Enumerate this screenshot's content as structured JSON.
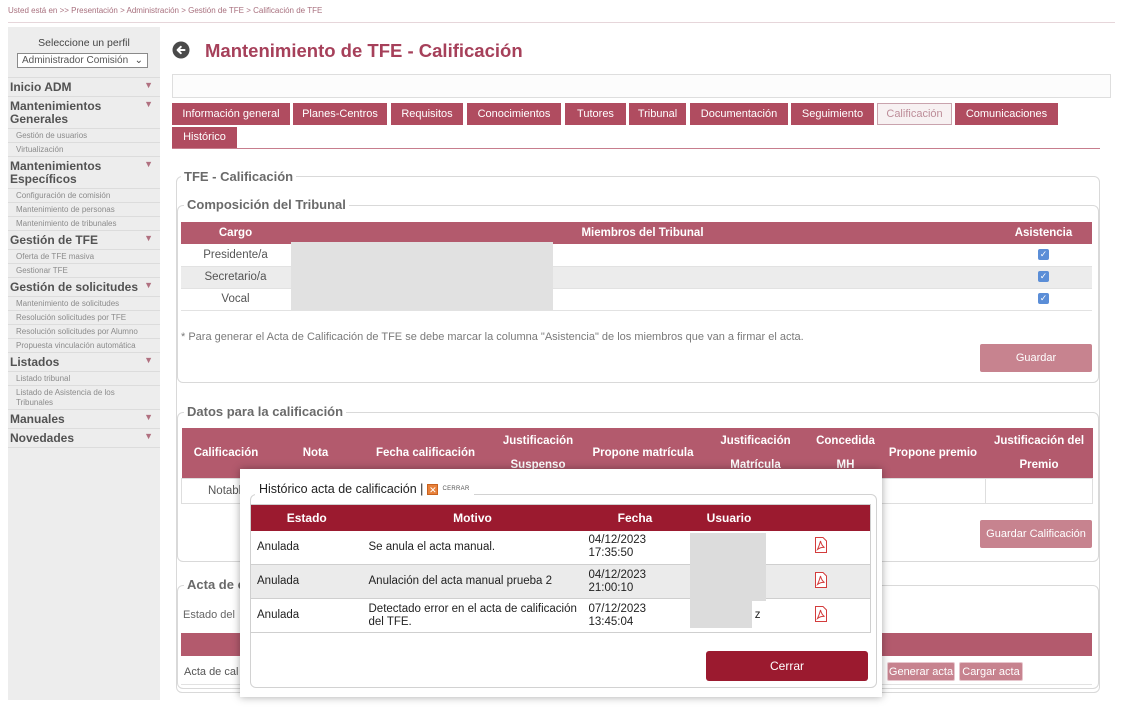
{
  "breadcrumb": "Usted está en >> Presentación > Administración > Gestión de TFE > Calificación de TFE",
  "sidebar": {
    "profile_label": "Seleccione un perfil",
    "profile_value": "Administrador Comisión",
    "menu": [
      {
        "label": "Inicio ADM",
        "items": []
      },
      {
        "label": "Mantenimientos Generales",
        "items": [
          "Gestión de usuarios",
          "Virtualización"
        ]
      },
      {
        "label": "Mantenimientos Específicos",
        "items": [
          "Configuración de comisión",
          "Mantenimiento de personas",
          "Mantenimiento de tribunales"
        ]
      },
      {
        "label": "Gestión de TFE",
        "items": [
          "Oferta de TFE masiva",
          "Gestionar TFE"
        ]
      },
      {
        "label": "Gestión de solicitudes",
        "items": [
          "Mantenimiento de solicitudes",
          "Resolución solicitudes por TFE",
          "Resolución solicitudes por Alumno",
          "Propuesta vinculación automática"
        ]
      },
      {
        "label": "Listados",
        "items": [
          "Listado tribunal",
          "Listado de Asistencia de los Tribunales"
        ]
      },
      {
        "label": "Manuales",
        "items": []
      },
      {
        "label": "Novedades",
        "items": []
      }
    ]
  },
  "page": {
    "title": "Mantenimiento de TFE - Calificación"
  },
  "tabs": {
    "row1": [
      "Información general",
      "Planes-Centros",
      "Requisitos",
      "Conocimientos",
      "Tutores",
      "Tribunal",
      "Documentación",
      "Seguimiento",
      "Calificación",
      "Comunicaciones"
    ],
    "row2": [
      "Histórico"
    ],
    "active": "Calificación"
  },
  "section": {
    "legend": "TFE - Calificación"
  },
  "tribunal": {
    "legend": "Composición del Tribunal",
    "headers": [
      "Cargo",
      "Miembros del Tribunal",
      "Asistencia"
    ],
    "rows": [
      {
        "cargo": "Presidente/a",
        "asistencia": true
      },
      {
        "cargo": "Secretario/a",
        "asistencia": true
      },
      {
        "cargo": "Vocal",
        "asistencia": true
      }
    ],
    "note": "* Para generar el Acta de Calificación de TFE se debe marcar la columna \"Asistencia\" de los miembros que van a firmar el acta.",
    "save": "Guardar"
  },
  "datos": {
    "legend": "Datos para la calificación",
    "headers": [
      "Calificación",
      "Nota",
      "Fecha calificación",
      "Justificación Suspenso",
      "Propone matrícula",
      "Justificación Matrícula",
      "Concedida MH",
      "Propone premio",
      "Justificación del Premio"
    ],
    "row": {
      "calificacion": "Notabl"
    },
    "save": "Guardar Calificación"
  },
  "acta": {
    "legend": "Acta de c",
    "estado_label": "Estado del",
    "row_label": "Acta de cal",
    "generar": "Generar acta",
    "cargar": "Cargar acta"
  },
  "modal": {
    "title": "Histórico acta de calificación |",
    "close_label": "CERRAR",
    "headers": [
      "Estado",
      "Motivo",
      "Fecha",
      "Usuario"
    ],
    "rows": [
      {
        "estado": "Anulada",
        "motivo": "Se anula el acta manual.",
        "fecha": "04/12/2023",
        "hora": "17:35:50",
        "usuario": ""
      },
      {
        "estado": "Anulada",
        "motivo": "Anulación del acta manual prueba 2",
        "fecha": "04/12/2023",
        "hora": "21:00:10",
        "usuario": ""
      },
      {
        "estado": "Anulada",
        "motivo": "Detectado error en el acta de calificación del TFE.",
        "fecha": "07/12/2023",
        "hora": "13:45:04",
        "usuario": "z"
      }
    ],
    "button": "Cerrar"
  },
  "icons": {
    "back": "circle-arrow-left-icon",
    "select": "chevron-down-icon",
    "menu": "chevron-down-icon",
    "checkbox": "checkbox-checked-icon",
    "close": "close-icon",
    "pdf": "pdf-icon"
  },
  "colors": {
    "title": "#a6405a",
    "tab": "#b04c60",
    "table_header": "#b35a6d",
    "modal_header": "#9b1a2f",
    "button": "#c7838f",
    "checkbox": "#5b8ed7",
    "sidebar_bg": "#ededed"
  }
}
